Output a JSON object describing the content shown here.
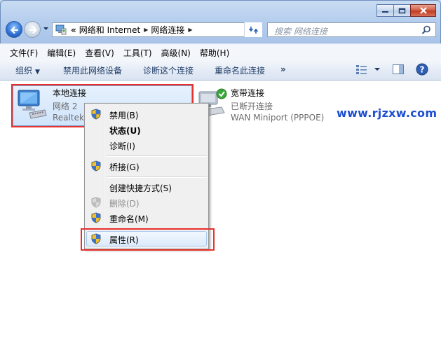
{
  "nav": {
    "breadcrumb_prefix": "«",
    "breadcrumb": [
      "网络和 Internet",
      "网络连接"
    ],
    "search_placeholder": "搜索 网络连接"
  },
  "menubar": [
    "文件(F)",
    "编辑(E)",
    "查看(V)",
    "工具(T)",
    "高级(N)",
    "帮助(H)"
  ],
  "commandbar": {
    "organize": "组织",
    "disable": "禁用此网络设备",
    "diagnose": "诊断这个连接",
    "rename": "重命名此连接",
    "more": "»"
  },
  "connections": [
    {
      "name": "本地连接",
      "status": "网络 2",
      "device": "Realtek"
    },
    {
      "name": "宽带连接",
      "status": "已断开连接",
      "device": "WAN Miniport (PPPOE)"
    }
  ],
  "watermark": "www.rjzxw.com",
  "context_menu": {
    "items": [
      {
        "label": "禁用(B)",
        "icon": "uac-shield-icon",
        "state": "normal"
      },
      {
        "label": "状态(U)",
        "icon": "",
        "state": "default-bold"
      },
      {
        "label": "诊断(I)",
        "icon": "",
        "state": "normal"
      },
      {
        "label": "桥接(G)",
        "icon": "uac-shield-icon",
        "state": "normal"
      },
      {
        "label": "创建快捷方式(S)",
        "icon": "",
        "state": "normal"
      },
      {
        "label": "删除(D)",
        "icon": "uac-shield-icon",
        "state": "disabled"
      },
      {
        "label": "重命名(M)",
        "icon": "uac-shield-icon",
        "state": "normal"
      },
      {
        "label": "属性(R)",
        "icon": "uac-shield-icon",
        "state": "selected"
      }
    ]
  },
  "colors": {
    "highlight_box": "#e8302c",
    "selection": "#cfe4fb",
    "watermark": "#1e4fd0"
  }
}
